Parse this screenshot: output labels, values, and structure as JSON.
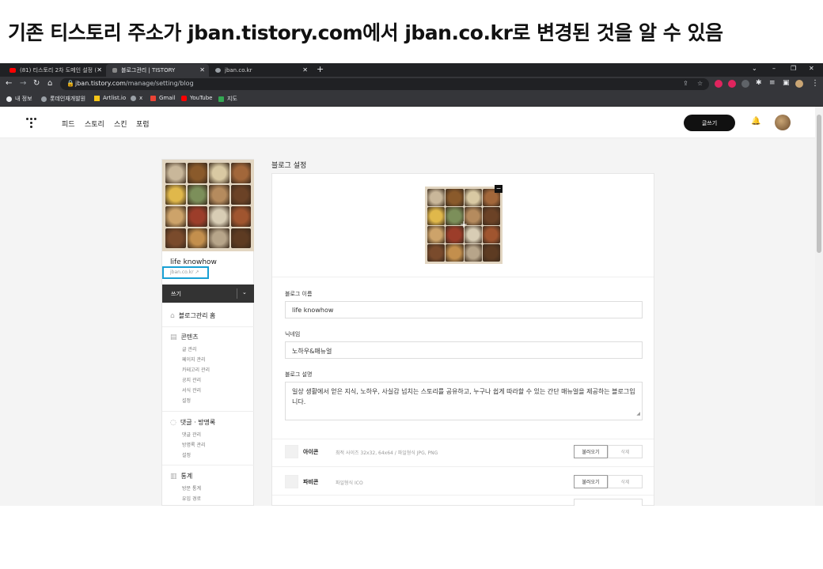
{
  "caption": "기존 티스토리 주소가 jban.tistory.com에서 jban.co.kr로 변경된 것을 알 수 있음",
  "browser": {
    "tabs": [
      {
        "label": "(81) 티스토리 2차 도메인 설정 (",
        "favicon": "youtube-icon",
        "color": "#ff0000"
      },
      {
        "label": "블로그관리 | TISTORY",
        "favicon": "tistory-icon",
        "color": "#888888"
      },
      {
        "label": "jban.co.kr",
        "favicon": "globe-icon",
        "color": "#9aa0a6"
      }
    ],
    "tab_close": "✕",
    "new_tab": "+",
    "window_controls": [
      "⌄",
      "–",
      "❐",
      "✕"
    ],
    "url_domain": "jban.tistory.com",
    "url_path": "/manage/setting/blog",
    "bookmarks": [
      "내 정보",
      "롯데인재개발원",
      "Artlist.io",
      "x",
      "Gmail",
      "YouTube",
      "지도"
    ]
  },
  "tistory": {
    "nav": [
      "피드",
      "스토리",
      "스킨",
      "포럼"
    ],
    "write_button": "글쓰기"
  },
  "sidebar": {
    "blog_name": "life knowhow",
    "blog_domain": "jban.co.kr ↗",
    "write": "쓰기",
    "menu_home": "블로그관리 홈",
    "content_head": "콘텐츠",
    "content_items": [
      "글 관리",
      "페이지 관리",
      "카테고리 관리",
      "공지 관리",
      "서식 관리",
      "설정"
    ],
    "comment_head": "댓글 · 방명록",
    "comment_items": [
      "댓글 관리",
      "방명록 관리",
      "설정"
    ],
    "stats_head": "통계",
    "stats_items": [
      "방문 통계",
      "유입 경로"
    ]
  },
  "main": {
    "title": "블로그 설정",
    "blog_name_label": "블로그 이름",
    "blog_name_value": "life knowhow",
    "nickname_label": "닉네임",
    "nickname_value": "노하우&매뉴얼",
    "desc_label": "블로그 설명",
    "desc_value": "일상 생활에서 얻은 지식, 노하우, 사실감 넘치는 스토리를 공유하고, 누구나 쉽게 따라할 수 있는 간단 매뉴얼을 제공하는 블로그입니다.",
    "icon_title": "아이콘",
    "icon_desc": "최적 사이즈 32x32, 64x64 / 파일형식 JPG, PNG",
    "favicon_title": "파비콘",
    "favicon_desc": "파일형식 ICO",
    "load_button": "불러오기",
    "delete_button": "삭제"
  },
  "food_colors": [
    "#c9b79a",
    "#8a5a2b",
    "#d9c9a3",
    "#a2673a",
    "#e0b84b",
    "#7c8f5a",
    "#b58b5e",
    "#6b4226",
    "#cda36a",
    "#9c3d2a",
    "#d8cdb5",
    "#a0552f",
    "#7a4b2c",
    "#c38f4d",
    "#b7a58a",
    "#5d3b22"
  ]
}
